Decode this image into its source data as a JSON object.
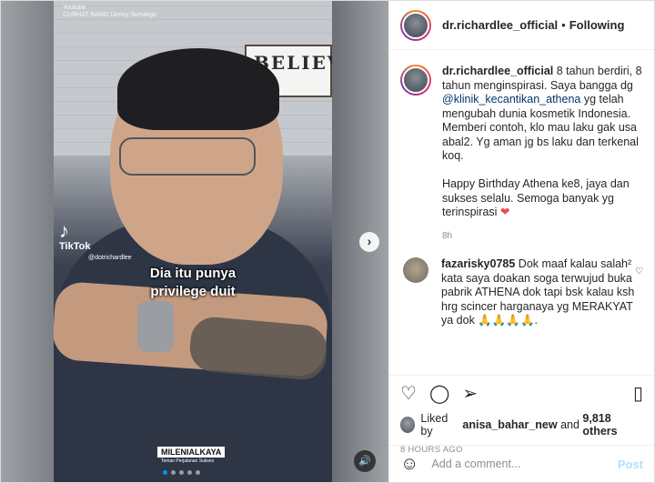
{
  "media": {
    "watermark": "Youtube\nCURHAT BANG Denny Sumargo",
    "poster_text": "BELIEV",
    "tiktok": {
      "label": "TikTok",
      "handle": "@dotrichardlee"
    },
    "caption_line1": "Dia itu punya",
    "caption_line2": "privilege duit",
    "brand": "MILENIALKAYA",
    "brand_sub": "Teman Perjalanan Sukses",
    "next_icon": "chevron-right-icon",
    "sound_icon": "speaker-icon",
    "dots": {
      "count": 5,
      "active": 1
    }
  },
  "header": {
    "username": "dr.richardlee_official",
    "separator": "•",
    "follow_label": "Following"
  },
  "caption": {
    "username": "dr.richardlee_official",
    "text_before": " 8 tahun berdiri, 8 tahun menginspirasi. Saya bangga dg ",
    "mention": "@klinik_kecantikan_athena",
    "text_after": " yg telah mengubah dunia kosmetik Indonesia. Memberi contoh, klo mau laku gak usa abal2. Yg aman jg bs laku dan terkenal koq.",
    "text_2": "Happy Birthday Athena ke8, jaya dan sukses selalu. Semoga banyak yg terinspirasi ",
    "heart": "❤",
    "time": "8h"
  },
  "comment": {
    "username": "fazarisky0785",
    "text": " Dok maaf kalau salah² kata saya doakan soga terwujud buka pabrik ATHENA dok tapi bsk kalau ksh hrg scincer harganaya yg MERAKYAT ya dok 🙏🙏🙏🙏."
  },
  "actions": {
    "like_icon": "heart-icon",
    "comment_icon": "comment-icon",
    "share_icon": "share-icon",
    "save_icon": "bookmark-icon",
    "liked_by_prefix": "Liked by ",
    "liked_by_user": "anisa_bahar_new",
    "liked_by_and": " and ",
    "liked_by_count": "9,818 others",
    "posted": "8 HOURS AGO"
  },
  "add_comment": {
    "placeholder": "Add a comment...",
    "post_label": "Post"
  },
  "colors": {
    "accent": "#0095f6",
    "mention": "#00376b",
    "heart": "#ed4956",
    "post_disabled": "#b2dffc"
  }
}
